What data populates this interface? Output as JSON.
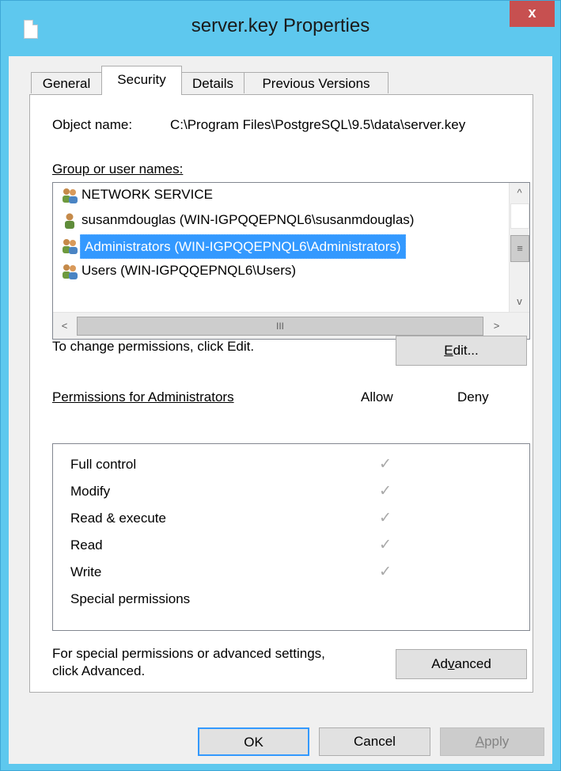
{
  "window": {
    "title": "server.key Properties",
    "close_label": "x"
  },
  "tabs": [
    {
      "label": "General",
      "active": false
    },
    {
      "label": "Security",
      "active": true
    },
    {
      "label": "Details",
      "active": false
    },
    {
      "label": "Previous Versions",
      "active": false
    }
  ],
  "object": {
    "label": "Object name:",
    "value": "C:\\Program Files\\PostgreSQL\\9.5\\data\\server.key"
  },
  "groups": {
    "label": "Group or user names:",
    "items": [
      {
        "label": "NETWORK SERVICE",
        "icon": "user-group-icon",
        "selected": false
      },
      {
        "label": "susanmdouglas (WIN-IGPQQEPNQL6\\susanmdouglas)",
        "icon": "user-icon",
        "selected": false
      },
      {
        "label": "Administrators (WIN-IGPQQEPNQL6\\Administrators)",
        "icon": "user-group-icon",
        "selected": true
      },
      {
        "label": "Users (WIN-IGPQQEPNQL6\\Users)",
        "icon": "user-group-icon",
        "selected": false
      }
    ],
    "scroll_up": "^",
    "scroll_down": "v",
    "scroll_grip": "≡",
    "hscroll_left": "<",
    "hscroll_right": ">",
    "hscroll_grip": "III"
  },
  "change_hint": "To change permissions, click Edit.",
  "edit_button": {
    "pre": "",
    "accel": "E",
    "post": "dit..."
  },
  "permissions": {
    "header": "Permissions for Administrators",
    "allow_label": "Allow",
    "deny_label": "Deny",
    "items": [
      {
        "label": "Full control",
        "allow": true,
        "deny": false
      },
      {
        "label": "Modify",
        "allow": true,
        "deny": false
      },
      {
        "label": "Read & execute",
        "allow": true,
        "deny": false
      },
      {
        "label": "Read",
        "allow": true,
        "deny": false
      },
      {
        "label": "Write",
        "allow": true,
        "deny": false
      },
      {
        "label": "Special permissions",
        "allow": false,
        "deny": false
      }
    ],
    "check_glyph": "✓"
  },
  "advanced": {
    "hint_line1": "For special permissions or advanced settings,",
    "hint_line2": "click Advanced.",
    "button": {
      "pre": "Ad",
      "accel": "v",
      "post": "anced"
    }
  },
  "footer": {
    "ok_label": "OK",
    "cancel_label": "Cancel",
    "apply": {
      "pre": "",
      "accel": "A",
      "post": "pply"
    }
  },
  "colors": {
    "titlebar": "#5ec8ee",
    "close": "#c75050",
    "selection": "#3399ff",
    "check": "#a8a8a8"
  }
}
